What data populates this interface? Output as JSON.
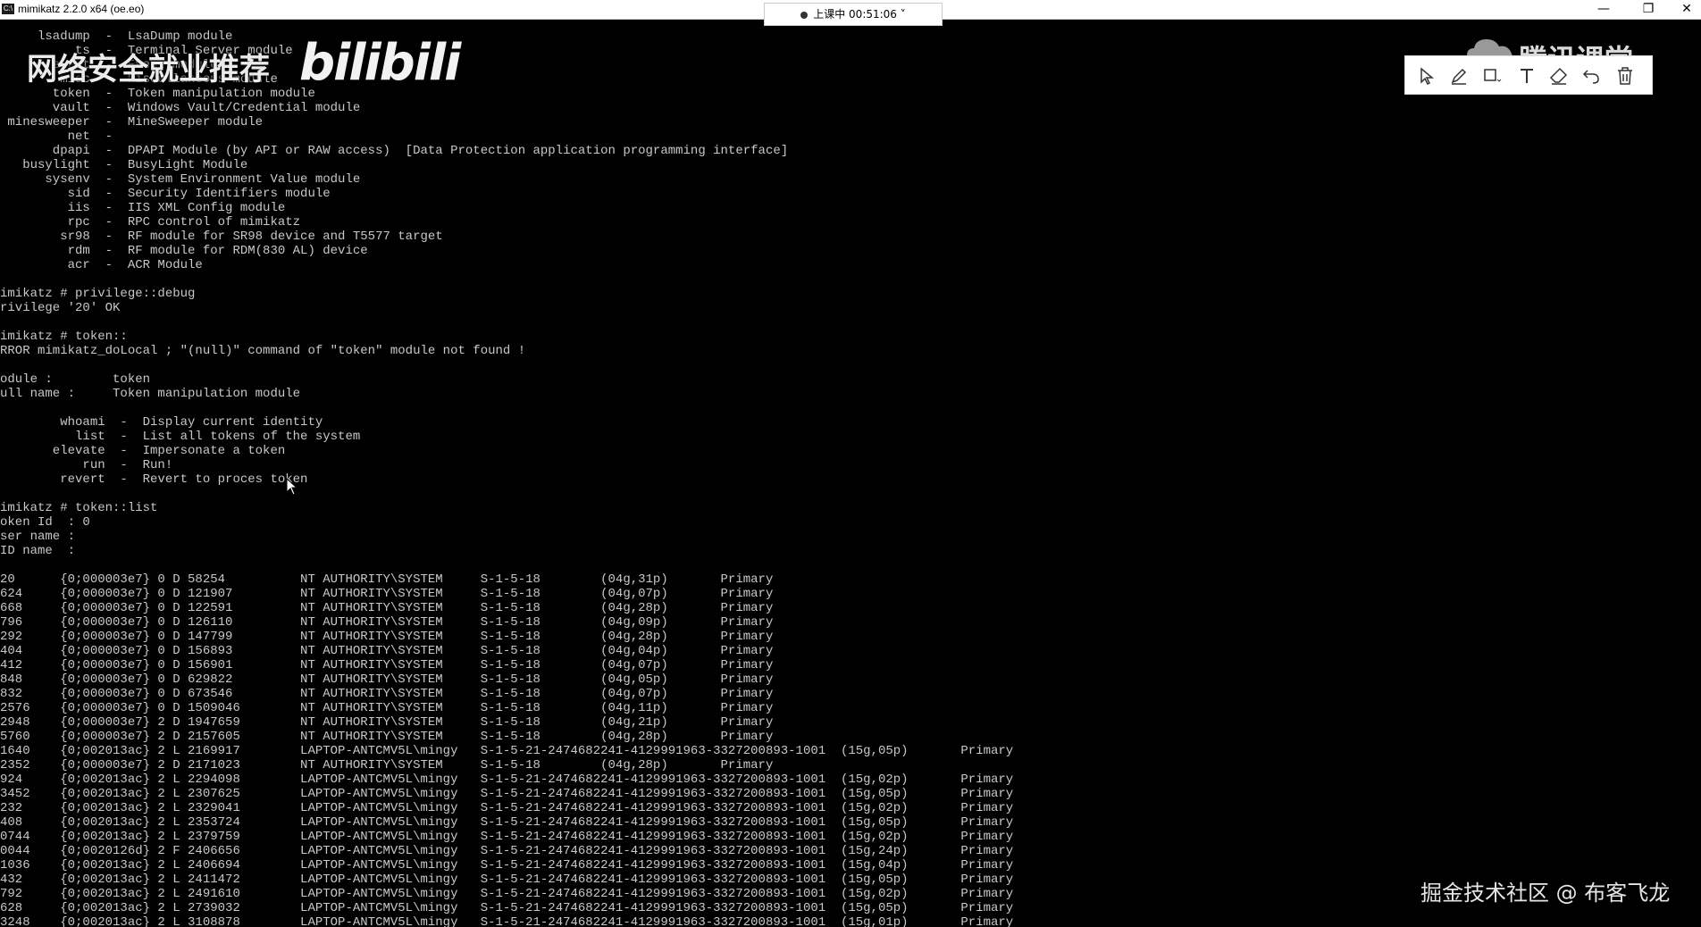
{
  "window": {
    "app_icon": "cmd-icon",
    "title": "mimikatz 2.2.0 x64 (oe.eo)",
    "minimize": "—",
    "maximize": "❐",
    "close": "✕"
  },
  "class_timer": {
    "label": "上课中 00:51:06 ˅"
  },
  "watermarks": {
    "left_text": "网络安全就业推荐",
    "left_brand": "bilibili",
    "right_text": "腾讯课堂",
    "bottom_text": "掘金技术社区 @ 布客飞龙"
  },
  "toolbar": {
    "tools": [
      "select-icon",
      "pen-icon",
      "shape-icon",
      "text-icon",
      "eraser-icon",
      "undo-icon",
      "delete-icon"
    ]
  },
  "terminal": {
    "lines": [
      "     lsadump  -  LsaDump module",
      "          ts  -  Terminal Server module",
      "       event  -  Event module",
      "        misc  -  Miscellaneous module",
      "       token  -  Token manipulation module",
      "       vault  -  Windows Vault/Credential module",
      " minesweeper  -  MineSweeper module",
      "         net  -",
      "       dpapi  -  DPAPI Module (by API or RAW access)  [Data Protection application programming interface]",
      "   busylight  -  BusyLight Module",
      "      sysenv  -  System Environment Value module",
      "         sid  -  Security Identifiers module",
      "         iis  -  IIS XML Config module",
      "         rpc  -  RPC control of mimikatz",
      "        sr98  -  RF module for SR98 device and T5577 target",
      "         rdm  -  RF module for RDM(830 AL) device",
      "         acr  -  ACR Module",
      "",
      "imikatz # privilege::debug",
      "rivilege '20' OK",
      "",
      "imikatz # token::",
      "RROR mimikatz_doLocal ; \"(null)\" command of \"token\" module not found !",
      "",
      "odule :        token",
      "ull name :     Token manipulation module",
      "",
      "        whoami  -  Display current identity",
      "          list  -  List all tokens of the system",
      "       elevate  -  Impersonate a token",
      "           run  -  Run!",
      "        revert  -  Revert to proces token",
      "",
      "imikatz # token::list",
      "oken Id  : 0",
      "ser name :",
      "ID name  :",
      "",
      "20      {0;000003e7} 0 D 58254          NT AUTHORITY\\SYSTEM     S-1-5-18        (04g,31p)       Primary",
      "624     {0;000003e7} 0 D 121907         NT AUTHORITY\\SYSTEM     S-1-5-18        (04g,07p)       Primary",
      "668     {0;000003e7} 0 D 122591         NT AUTHORITY\\SYSTEM     S-1-5-18        (04g,28p)       Primary",
      "796     {0;000003e7} 0 D 126110         NT AUTHORITY\\SYSTEM     S-1-5-18        (04g,09p)       Primary",
      "292     {0;000003e7} 0 D 147799         NT AUTHORITY\\SYSTEM     S-1-5-18        (04g,28p)       Primary",
      "404     {0;000003e7} 0 D 156893         NT AUTHORITY\\SYSTEM     S-1-5-18        (04g,04p)       Primary",
      "412     {0;000003e7} 0 D 156901         NT AUTHORITY\\SYSTEM     S-1-5-18        (04g,07p)       Primary",
      "848     {0;000003e7} 0 D 629822         NT AUTHORITY\\SYSTEM     S-1-5-18        (04g,05p)       Primary",
      "832     {0;000003e7} 0 D 673546         NT AUTHORITY\\SYSTEM     S-1-5-18        (04g,07p)       Primary",
      "2576    {0;000003e7} 0 D 1509046        NT AUTHORITY\\SYSTEM     S-1-5-18        (04g,11p)       Primary",
      "2948    {0;000003e7} 2 D 1947659        NT AUTHORITY\\SYSTEM     S-1-5-18        (04g,21p)       Primary",
      "5760    {0;000003e7} 2 D 2157605        NT AUTHORITY\\SYSTEM     S-1-5-18        (04g,28p)       Primary",
      "1640    {0;002013ac} 2 L 2169917        LAPTOP-ANTCMV5L\\mingy   S-1-5-21-2474682241-4129991963-3327200893-1001  (15g,05p)       Primary",
      "2352    {0;000003e7} 2 D 2171023        NT AUTHORITY\\SYSTEM     S-1-5-18        (04g,28p)       Primary",
      "924     {0;002013ac} 2 L 2294098        LAPTOP-ANTCMV5L\\mingy   S-1-5-21-2474682241-4129991963-3327200893-1001  (15g,02p)       Primary",
      "3452    {0;002013ac} 2 L 2307625        LAPTOP-ANTCMV5L\\mingy   S-1-5-21-2474682241-4129991963-3327200893-1001  (15g,05p)       Primary",
      "232     {0;002013ac} 2 L 2329041        LAPTOP-ANTCMV5L\\mingy   S-1-5-21-2474682241-4129991963-3327200893-1001  (15g,02p)       Primary",
      "408     {0;002013ac} 2 L 2353724        LAPTOP-ANTCMV5L\\mingy   S-1-5-21-2474682241-4129991963-3327200893-1001  (15g,05p)       Primary",
      "0744    {0;002013ac} 2 L 2379759        LAPTOP-ANTCMV5L\\mingy   S-1-5-21-2474682241-4129991963-3327200893-1001  (15g,02p)       Primary",
      "0044    {0;0020126d} 2 F 2406656        LAPTOP-ANTCMV5L\\mingy   S-1-5-21-2474682241-4129991963-3327200893-1001  (15g,24p)       Primary",
      "1036    {0;002013ac} 2 L 2406694        LAPTOP-ANTCMV5L\\mingy   S-1-5-21-2474682241-4129991963-3327200893-1001  (15g,04p)       Primary",
      "432     {0;002013ac} 2 L 2411472        LAPTOP-ANTCMV5L\\mingy   S-1-5-21-2474682241-4129991963-3327200893-1001  (15g,05p)       Primary",
      "792     {0;002013ac} 2 L 2491610        LAPTOP-ANTCMV5L\\mingy   S-1-5-21-2474682241-4129991963-3327200893-1001  (15g,02p)       Primary",
      "628     {0;002013ac} 2 L 2739032        LAPTOP-ANTCMV5L\\mingy   S-1-5-21-2474682241-4129991963-3327200893-1001  (15g,05p)       Primary",
      "3248    {0;002013ac} 2 L 3108878        LAPTOP-ANTCMV5L\\mingy   S-1-5-21-2474682241-4129991963-3327200893-1001  (15g,01p)       Primary"
    ]
  }
}
